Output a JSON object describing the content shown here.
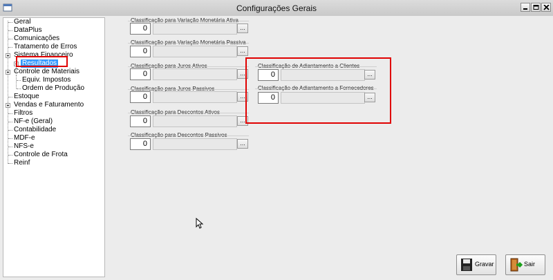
{
  "window": {
    "title": "Configurações Gerais"
  },
  "tree": {
    "items": [
      {
        "label": "Geral"
      },
      {
        "label": "DataPlus"
      },
      {
        "label": "Comunicações"
      },
      {
        "label": "Tratamento de Erros"
      },
      {
        "label": "Sistema Financeiro"
      },
      {
        "label": "Resultados"
      },
      {
        "label": "Controle de Materiais"
      },
      {
        "label": "Equiv. Impostos"
      },
      {
        "label": "Ordem de Produção"
      },
      {
        "label": "Estoque"
      },
      {
        "label": "Vendas e Faturamento"
      },
      {
        "label": "Filtros"
      },
      {
        "label": "NF-e (Geral)"
      },
      {
        "label": "Contabilidade"
      },
      {
        "label": "MDF-e"
      },
      {
        "label": "NFS-e"
      },
      {
        "label": "Controle de Frota"
      },
      {
        "label": "Reinf"
      }
    ]
  },
  "fields": [
    {
      "label": "Classificação para Variação Monetária Ativa",
      "value": "0"
    },
    {
      "label": "Classificação para Variação Monetária Passiva",
      "value": "0"
    },
    {
      "label": "Classificação para Juros Ativos",
      "value": "0"
    },
    {
      "label": "Classificação para Juros Passivos",
      "value": "0"
    },
    {
      "label": "Classificação para Descontos Ativos",
      "value": "0"
    },
    {
      "label": "Classificação para Descontos Passivos",
      "value": "0"
    },
    {
      "label": "Classificação de Adiantamento a Clientes",
      "value": "0"
    },
    {
      "label": "Classificação de Adiantamento a Fornecedores",
      "value": "0"
    }
  ],
  "lookup_label": "...",
  "buttons": {
    "save": "Gravar",
    "exit": "Sair"
  },
  "colors": {
    "highlight": "#e00000",
    "selection": "#3399ff"
  }
}
